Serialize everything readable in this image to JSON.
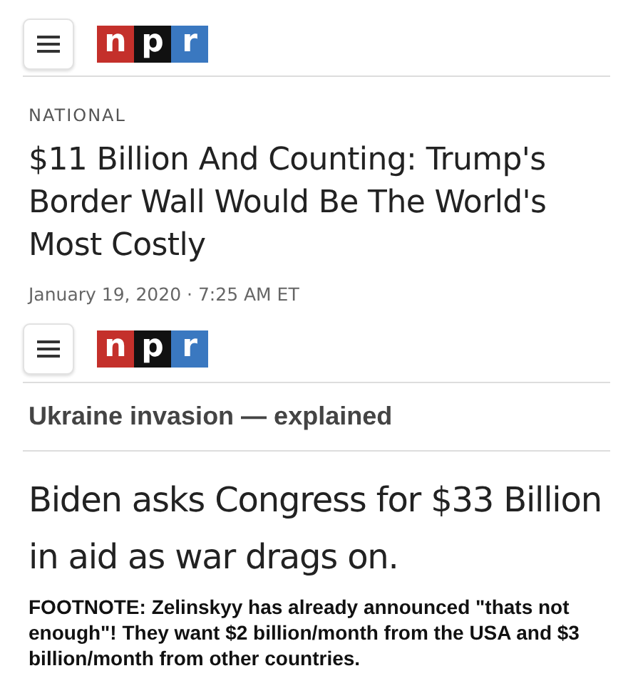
{
  "articles": [
    {
      "logo": [
        "n",
        "p",
        "r"
      ],
      "section": "NATIONAL",
      "headline": "$11 Billion And Counting: Trump's Border Wall Would Be The World's Most Costly",
      "date": "January 19, 2020 · 7:25 AM ET"
    },
    {
      "logo": [
        "n",
        "p",
        "r"
      ],
      "banner": "Ukraine invasion — explained",
      "headline": "Biden asks Congress for $33 Billion in aid as war drags on."
    }
  ],
  "footnote": "FOOTNOTE: Zelinskyy has already announced \"thats not enough\"! They want $2 billion/month from the USA and $3 billion/month from other countries."
}
